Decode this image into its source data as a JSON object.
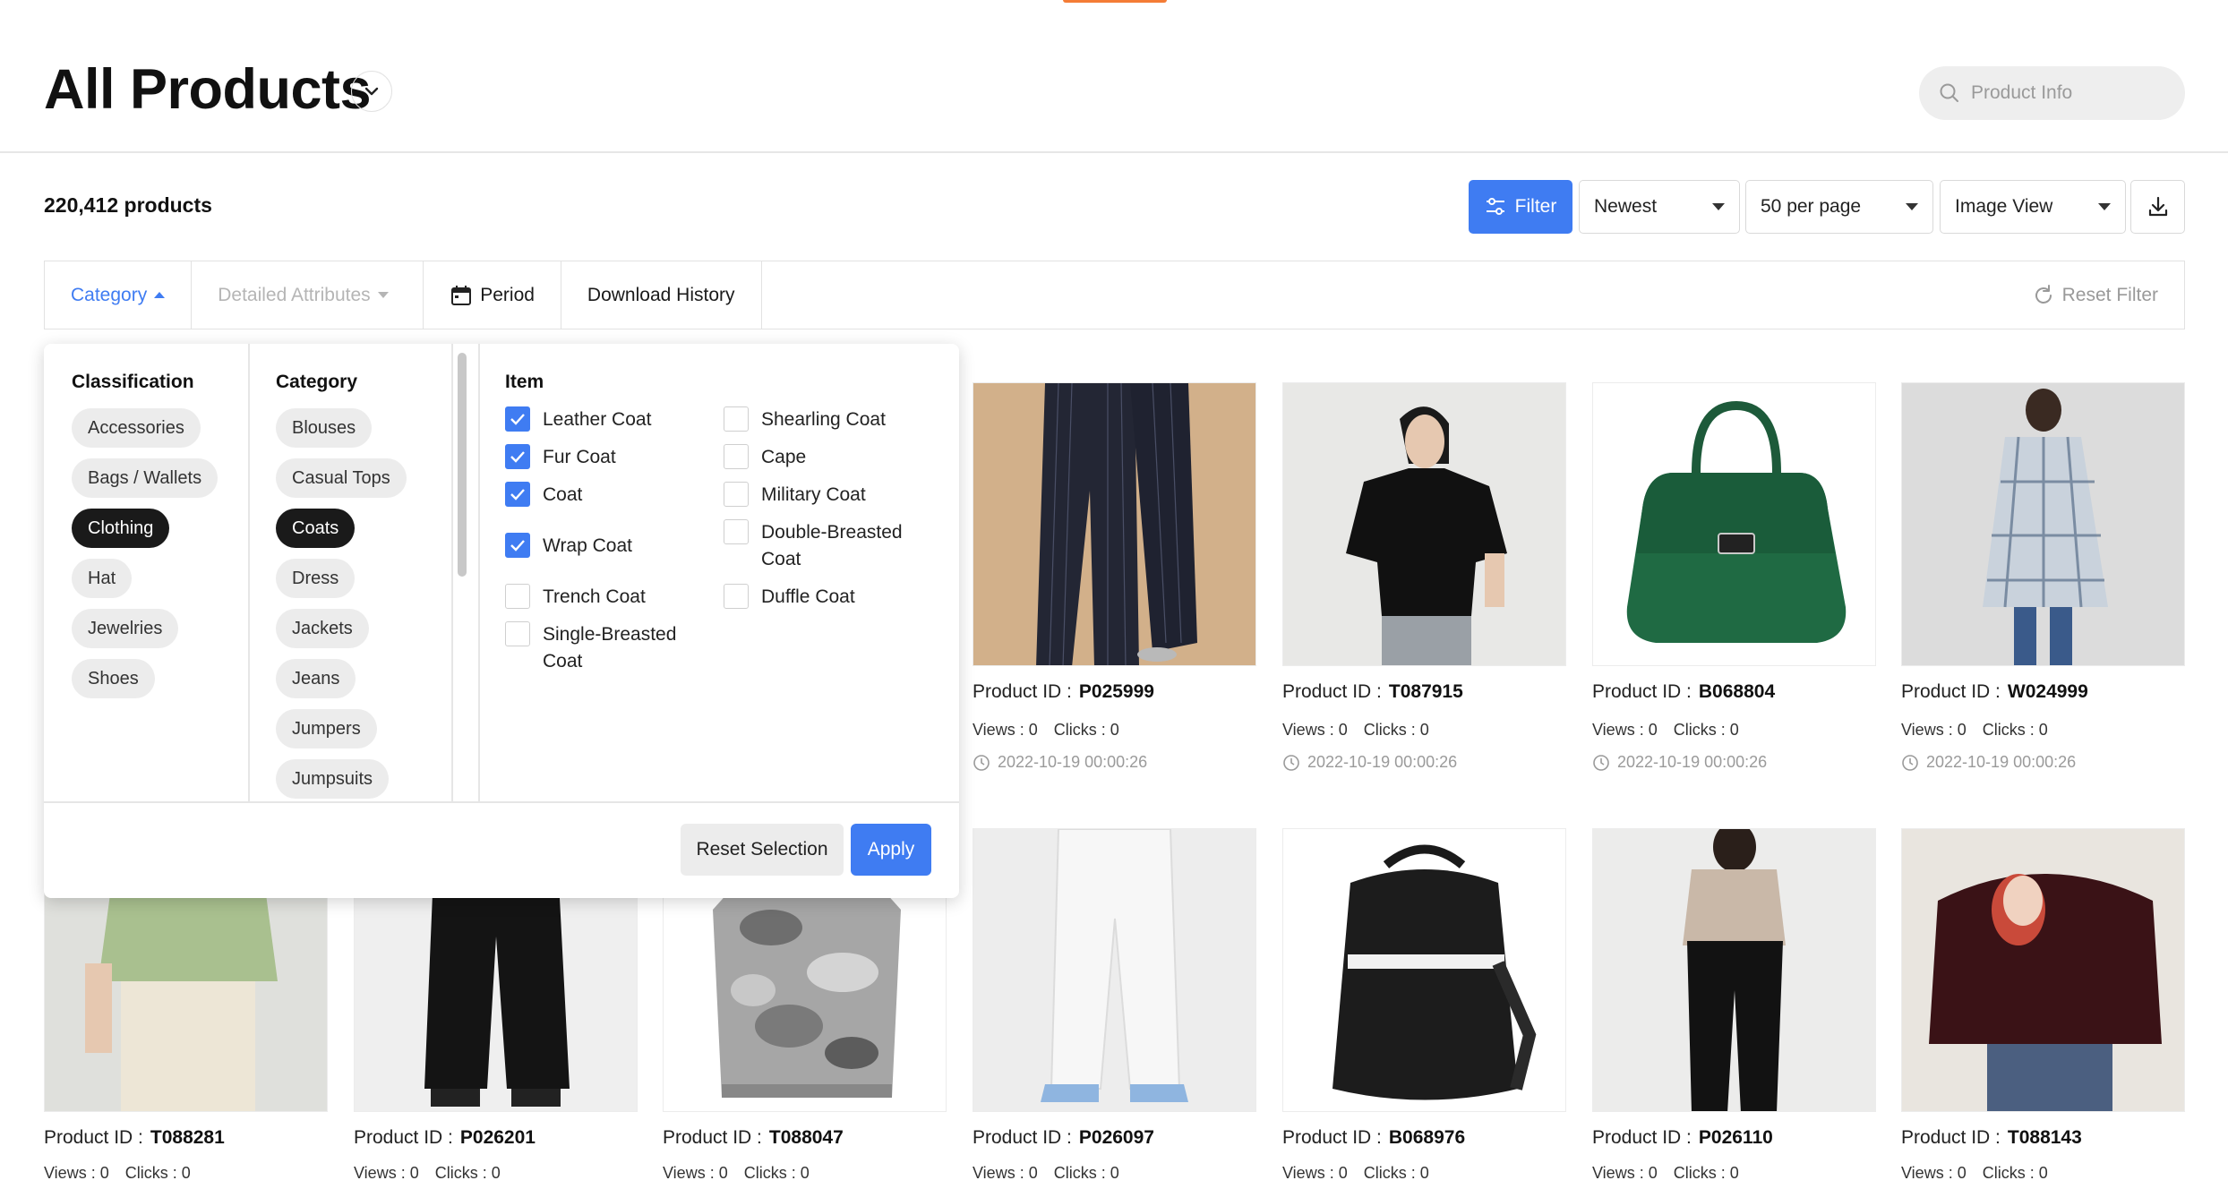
{
  "header": {
    "title": "All Products",
    "search_placeholder": "Product Info"
  },
  "toolbar": {
    "product_count": "220,412 products",
    "filter_label": "Filter",
    "sort_value": "Newest",
    "per_page_value": "50 per page",
    "view_value": "Image View"
  },
  "filter_bar": {
    "tabs": [
      "Category",
      "Detailed Attributes",
      "Period",
      "Download History"
    ],
    "reset_label": "Reset Filter"
  },
  "dropdown": {
    "classification_header": "Classification",
    "classifications": [
      {
        "label": "Accessories",
        "selected": false
      },
      {
        "label": "Bags / Wallets",
        "selected": false
      },
      {
        "label": "Clothing",
        "selected": true
      },
      {
        "label": "Hat",
        "selected": false
      },
      {
        "label": "Jewelries",
        "selected": false
      },
      {
        "label": "Shoes",
        "selected": false
      }
    ],
    "category_header": "Category",
    "categories": [
      {
        "label": "Blouses",
        "selected": false
      },
      {
        "label": "Casual Tops",
        "selected": false
      },
      {
        "label": "Coats",
        "selected": true
      },
      {
        "label": "Dress",
        "selected": false
      },
      {
        "label": "Jackets",
        "selected": false
      },
      {
        "label": "Jeans",
        "selected": false
      },
      {
        "label": "Jumpers",
        "selected": false
      },
      {
        "label": "Jumpsuits",
        "selected": false
      }
    ],
    "item_header": "Item",
    "items_left": [
      {
        "label": "Leather Coat",
        "checked": true
      },
      {
        "label": "Fur Coat",
        "checked": true
      },
      {
        "label": "Coat",
        "checked": true
      },
      {
        "label": "Wrap Coat",
        "checked": true
      },
      {
        "label": "Trench Coat",
        "checked": false
      },
      {
        "label": "Single-Breasted Coat",
        "checked": false
      }
    ],
    "items_right": [
      {
        "label": "Shearling Coat",
        "checked": false
      },
      {
        "label": "Cape",
        "checked": false
      },
      {
        "label": "Military Coat",
        "checked": false
      },
      {
        "label": "Double-Breasted Coat",
        "checked": false
      },
      {
        "label": "Duffle Coat",
        "checked": false
      }
    ],
    "reset_selection_label": "Reset Selection",
    "apply_label": "Apply"
  },
  "products_row1": [
    {
      "id_label": "Product ID :",
      "id": "P025999",
      "views": "Views : 0",
      "clicks": "Clicks : 0",
      "timestamp": "2022-10-19 00:00:26",
      "image": "striped-wide-trousers"
    },
    {
      "id_label": "Product ID :",
      "id": "T087915",
      "views": "Views : 0",
      "clicks": "Clicks : 0",
      "timestamp": "2022-10-19 00:00:26",
      "image": "black-tshirt"
    },
    {
      "id_label": "Product ID :",
      "id": "B068804",
      "views": "Views : 0",
      "clicks": "Clicks : 0",
      "timestamp": "2022-10-19 00:00:26",
      "image": "green-handbag"
    },
    {
      "id_label": "Product ID :",
      "id": "W024999",
      "views": "Views : 0",
      "clicks": "Clicks : 0",
      "timestamp": "2022-10-19 00:00:26",
      "image": "plaid-shirt-dress"
    }
  ],
  "products_row2": [
    {
      "id_label": "Product ID :",
      "id": "T088281",
      "views": "Views : 0",
      "clicks": "Clicks : 0",
      "image": "green-knit-top"
    },
    {
      "id_label": "Product ID :",
      "id": "P026201",
      "views": "Views : 0",
      "clicks": "Clicks : 0",
      "image": "black-wide-pants"
    },
    {
      "id_label": "Product ID :",
      "id": "T088047",
      "views": "Views : 0",
      "clicks": "Clicks : 0",
      "image": "camo-sweatshirt"
    },
    {
      "id_label": "Product ID :",
      "id": "P026097",
      "views": "Views : 0",
      "clicks": "Clicks : 0",
      "image": "white-jeans"
    },
    {
      "id_label": "Product ID :",
      "id": "B068976",
      "views": "Views : 0",
      "clicks": "Clicks : 0",
      "image": "black-backpack"
    },
    {
      "id_label": "Product ID :",
      "id": "P026110",
      "views": "Views : 0",
      "clicks": "Clicks : 0",
      "image": "black-trousers"
    },
    {
      "id_label": "Product ID :",
      "id": "T088143",
      "views": "Views : 0",
      "clicks": "Clicks : 0",
      "image": "burgundy-hoodie"
    }
  ],
  "colors": {
    "accent": "#3f7cf2",
    "top_accent": "#f47c36",
    "chip_selected": "#1a1a1a"
  }
}
